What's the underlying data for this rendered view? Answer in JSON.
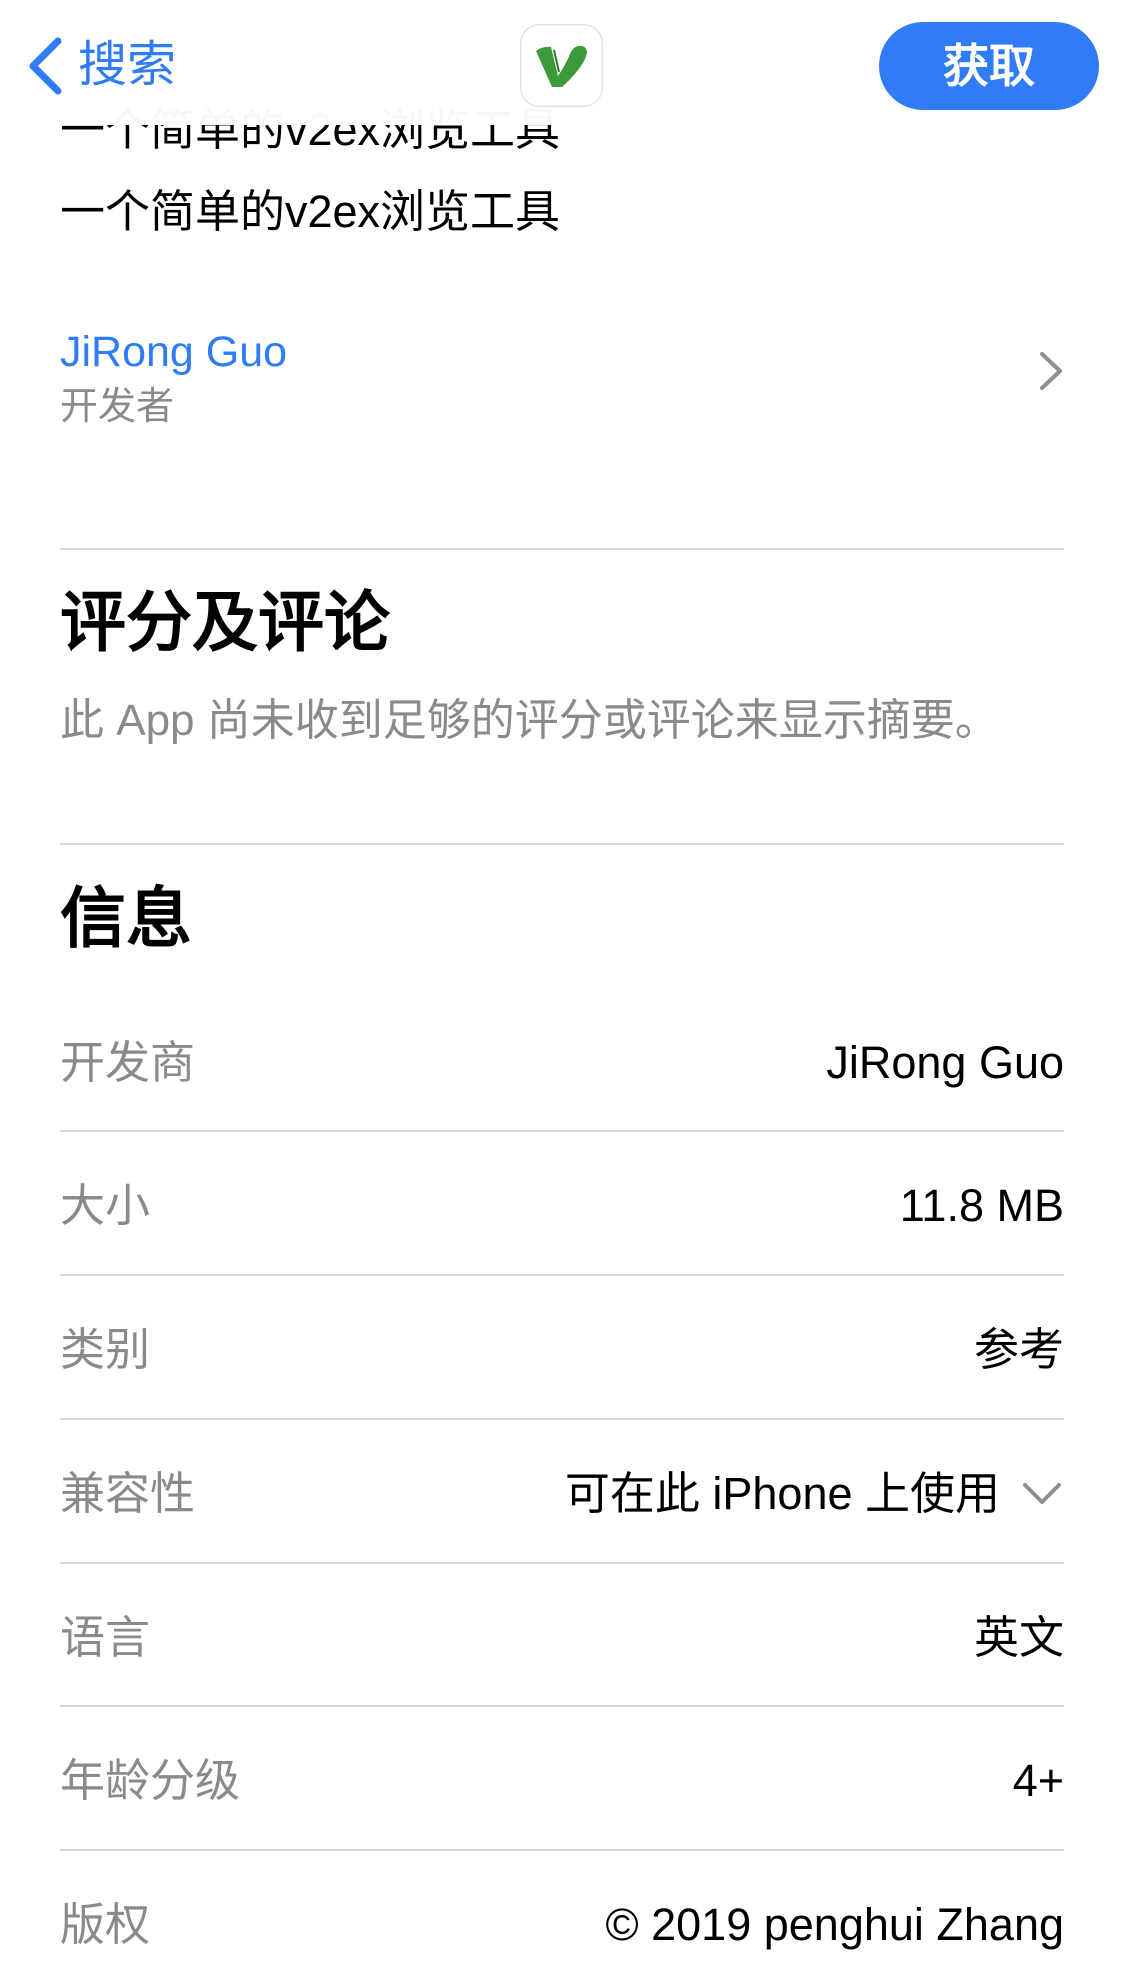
{
  "nav": {
    "back_label": "搜索",
    "back_icon": "chevron-left-icon",
    "app_icon": "v2ex-logo-icon",
    "get_label": "获取"
  },
  "description": {
    "lines": [
      "一个简单的v2ex浏览工具",
      "一个简单的v2ex浏览工具"
    ]
  },
  "developer_link": {
    "name": "JiRong Guo",
    "caption": "开发者",
    "icon": "chevron-right-icon"
  },
  "ratings": {
    "title": "评分及评论",
    "message": "此 App 尚未收到足够的评分或评论来显示摘要。"
  },
  "info": {
    "title": "信息",
    "rows": [
      {
        "label": "开发商",
        "value": "JiRong Guo"
      },
      {
        "label": "大小",
        "value": "11.8 MB"
      },
      {
        "label": "类别",
        "value": "参考"
      },
      {
        "label": "兼容性",
        "value": "可在此 iPhone 上使用",
        "icon": "chevron-down-icon"
      },
      {
        "label": "语言",
        "value": "英文"
      },
      {
        "label": "年龄分级",
        "value": "4+"
      },
      {
        "label": "版权",
        "value": "© 2019 penghui Zhang"
      }
    ]
  },
  "colors": {
    "accent": "#2F7CF6",
    "secondary_text": "#8A8A8E",
    "divider": "#D8D8DC",
    "icon_green": "#3C9A3A"
  }
}
